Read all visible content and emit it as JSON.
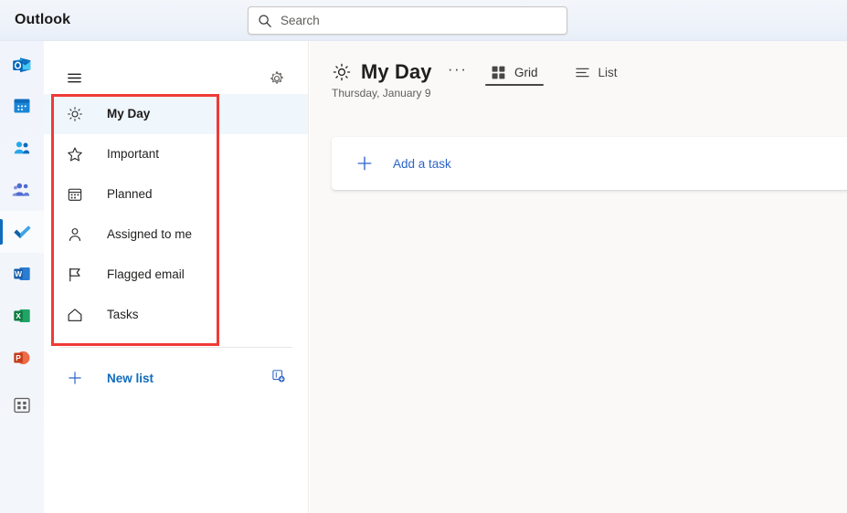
{
  "topbar": {
    "brand": "Outlook",
    "search": {
      "placeholder": "Search",
      "value": "",
      "icon": "search-icon"
    }
  },
  "app_rail": {
    "items": [
      {
        "name": "mail",
        "label": "Mail",
        "icon": "outlook-mail-icon",
        "selected": false
      },
      {
        "name": "calendar",
        "label": "Calendar",
        "icon": "calendar-icon",
        "selected": false
      },
      {
        "name": "people",
        "label": "People",
        "icon": "people-icon",
        "selected": false
      },
      {
        "name": "teams",
        "label": "Teams",
        "icon": "teams-icon",
        "selected": false
      },
      {
        "name": "todo",
        "label": "To Do",
        "icon": "todo-check-icon",
        "selected": true
      },
      {
        "name": "word",
        "label": "Word",
        "icon": "word-icon",
        "selected": false
      },
      {
        "name": "excel",
        "label": "Excel",
        "icon": "excel-icon",
        "selected": false
      },
      {
        "name": "powerpoint",
        "label": "PowerPoint",
        "icon": "powerpoint-icon",
        "selected": false
      },
      {
        "name": "apps",
        "label": "All apps",
        "icon": "app-grid-icon",
        "selected": false
      }
    ]
  },
  "sidebar": {
    "menu_button_icon": "hamburger-icon",
    "settings_button_icon": "gear-icon",
    "items": [
      {
        "label": "My Day",
        "icon": "sun-icon",
        "selected": true
      },
      {
        "label": "Important",
        "icon": "star-icon",
        "selected": false
      },
      {
        "label": "Planned",
        "icon": "calendar-icon",
        "selected": false
      },
      {
        "label": "Assigned to me",
        "icon": "person-icon",
        "selected": false
      },
      {
        "label": "Flagged email",
        "icon": "flag-icon",
        "selected": false
      },
      {
        "label": "Tasks",
        "icon": "home-icon",
        "selected": false
      }
    ],
    "new_list": {
      "label": "New list",
      "icon": "plus-icon",
      "new_group_icon": "new-group-icon"
    }
  },
  "main": {
    "title": "My Day",
    "title_icon": "sun-icon",
    "subtitle": "Thursday, January 9",
    "more_options_label": "···",
    "view_tabs": [
      {
        "label": "Grid",
        "icon": "grid-icon",
        "selected": true
      },
      {
        "label": "List",
        "icon": "list-icon",
        "selected": false
      }
    ],
    "add_task": {
      "label": "Add a task",
      "icon": "plus-icon"
    }
  },
  "annotation": {
    "type": "highlight-rectangle",
    "color": "#f03a36",
    "target": "sidebar-nav-list"
  },
  "colors": {
    "accent": "#0f6cbd",
    "link": "#2b63c6",
    "selected_row": "#eff6fc",
    "main_background": "#faf9f8",
    "annotation_red": "#f03a36"
  }
}
